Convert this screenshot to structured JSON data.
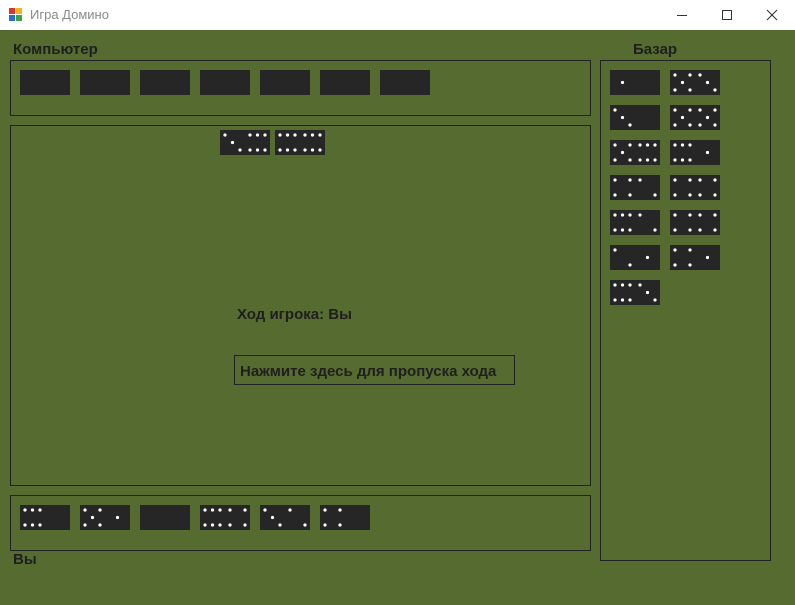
{
  "window": {
    "title": "Игра Домино",
    "icon": "app-dominoes-icon",
    "controls": [
      "minimize-icon",
      "maximize-icon",
      "close-icon"
    ]
  },
  "colors": {
    "background": "#556b2f",
    "tile": "#262626",
    "pip": "#ffffff",
    "text": "#1f1f1f"
  },
  "labels": {
    "computer": "Компьютер",
    "bazaar": "Базар",
    "player": "Вы"
  },
  "status": {
    "turn_text": "Ход игрока: Вы"
  },
  "skip_button": {
    "label": "Нажмите здесь для пропуска хода"
  },
  "computer_hand": {
    "count": 7,
    "face_down": true
  },
  "table_tiles": [
    [
      3,
      6
    ],
    [
      6,
      6
    ]
  ],
  "player_hand": [
    [
      6,
      0
    ],
    [
      5,
      1
    ],
    [
      0,
      0
    ],
    [
      6,
      4
    ],
    [
      3,
      2
    ],
    [
      4,
      0
    ]
  ],
  "bazaar_tiles": [
    [
      1,
      0
    ],
    [
      5,
      3
    ],
    [
      3,
      0
    ],
    [
      5,
      5
    ],
    [
      5,
      6
    ],
    [
      6,
      1
    ],
    [
      4,
      2
    ],
    [
      4,
      4
    ],
    [
      6,
      2
    ],
    [
      4,
      4
    ],
    [
      2,
      1
    ],
    [
      4,
      1
    ],
    [
      6,
      3
    ]
  ]
}
